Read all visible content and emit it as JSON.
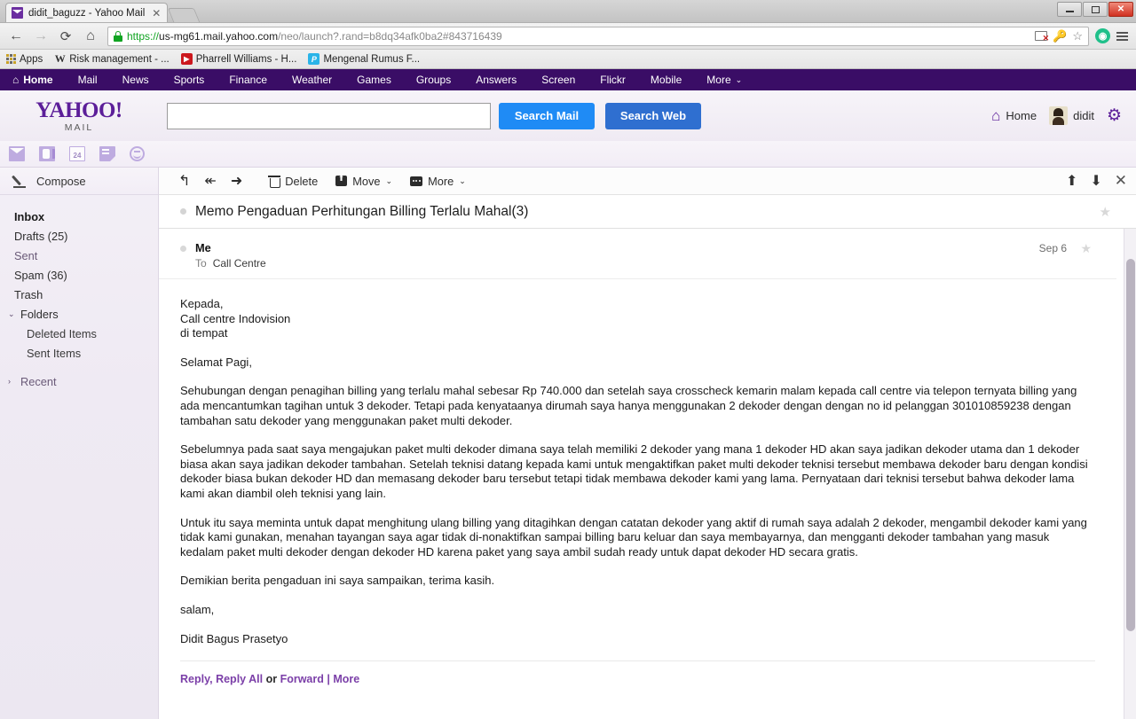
{
  "browser": {
    "tab_title": "didit_baguzz - Yahoo Mail",
    "tab_close": "✕",
    "url_scheme": "https://",
    "url_host": "us-mg61.mail.yahoo.com",
    "url_path": "/neo/launch?.rand=b8dq34afk0ba2#843716439",
    "back": "←",
    "forward": "→",
    "reload": "⟳",
    "home": "⌂",
    "minimize": "—",
    "maximize": "❐",
    "close": "✕",
    "bookmarks": [
      {
        "label": "Apps",
        "icon": "apps-grid-icon"
      },
      {
        "label": "Risk management - ...",
        "icon": "wikipedia-icon",
        "glyph": "W"
      },
      {
        "label": "Pharrell Williams - H...",
        "icon": "youtube-icon",
        "glyph": "▶"
      },
      {
        "label": "Mengenal Rumus F...",
        "icon": "site-icon",
        "glyph": "P"
      }
    ]
  },
  "yahoo_nav": {
    "items": [
      {
        "label": "Home",
        "icon": "home-icon"
      },
      {
        "label": "Mail"
      },
      {
        "label": "News"
      },
      {
        "label": "Sports"
      },
      {
        "label": "Finance"
      },
      {
        "label": "Weather"
      },
      {
        "label": "Games"
      },
      {
        "label": "Groups"
      },
      {
        "label": "Answers"
      },
      {
        "label": "Screen"
      },
      {
        "label": "Flickr"
      },
      {
        "label": "Mobile"
      },
      {
        "label": "More",
        "caret": "⌄"
      }
    ]
  },
  "mail_header": {
    "logo_main": "YAHOO!",
    "logo_sub": "MAIL",
    "search_value": "",
    "search_placeholder": "",
    "search_mail_label": "Search Mail",
    "search_web_label": "Search Web",
    "home_label": "Home",
    "user_name": "didit",
    "gear": "⚙"
  },
  "app_strip": {
    "icons": [
      "mail-icon",
      "contacts-icon",
      "calendar-icon",
      "notepad-icon",
      "smiley-icon"
    ],
    "calendar_number": "24"
  },
  "sidebar": {
    "compose_label": "Compose",
    "folders": [
      {
        "label": "Inbox",
        "state": "active"
      },
      {
        "label": "Drafts (25)",
        "state": "normal"
      },
      {
        "label": "Sent",
        "state": "normal"
      },
      {
        "label": "Spam (36)",
        "state": "normal"
      },
      {
        "label": "Trash",
        "state": "normal"
      },
      {
        "label": "Folders",
        "state": "group",
        "chev": "⌄"
      },
      {
        "label": "Deleted Items",
        "state": "sub"
      },
      {
        "label": "Sent Items",
        "state": "sub"
      },
      {
        "label": "Recent",
        "state": "group",
        "chev": "›"
      }
    ]
  },
  "toolbar": {
    "reply": "↰",
    "reply_all": "↞",
    "forward": "➜",
    "delete_label": "Delete",
    "move_label": "Move",
    "move_caret": "⌄",
    "more_label": "More",
    "more_caret": "⌄",
    "prev_message": "⬆",
    "next_message": "⬇",
    "close_message": "✕"
  },
  "message": {
    "subject": "Memo Pengaduan Perhitungan Billing Terlalu Mahal(3)",
    "sender": "Me",
    "to_label": "To",
    "to_recipient": "Call Centre",
    "date": "Sep 6",
    "star": "★",
    "paragraphs": [
      "Kepada,",
      "Call centre Indovision",
      "di tempat",
      "Selamat Pagi,",
      "Sehubungan dengan penagihan billing yang terlalu mahal sebesar Rp 740.000 dan  setelah saya crosscheck kemarin malam kepada call centre via telepon ternyata billing yang ada mencantumkan tagihan untuk 3 dekoder. Tetapi pada kenyataanya dirumah saya hanya menggunakan 2 dekoder dengan dengan no id pelanggan 301010859238 dengan tambahan satu dekoder yang menggunakan paket multi dekoder.",
      "Sebelumnya pada saat saya mengajukan paket multi dekoder dimana saya telah memiliki 2 dekoder yang mana 1 dekoder HD akan saya jadikan dekoder utama dan 1  dekoder biasa akan saya jadikan dekoder tambahan. Setelah teknisi datang kepada kami untuk mengaktifkan paket multi dekoder teknisi tersebut membawa dekoder baru dengan kondisi dekoder biasa bukan dekoder HD dan memasang dekoder baru tersebut tetapi tidak membawa dekoder kami yang lama. Pernyataan dari teknisi tersebut bahwa dekoder lama kami akan diambil oleh teknisi yang lain.",
      "Untuk itu saya meminta untuk dapat menghitung ulang billing yang ditagihkan dengan catatan dekoder yang aktif di rumah saya adalah 2 dekoder, mengambil dekoder kami yang tidak kami gunakan, menahan tayangan saya agar tidak di-nonaktifkan sampai billing baru keluar dan saya membayarnya, dan mengganti dekoder tambahan yang masuk kedalam paket multi dekoder dengan dekoder HD karena paket yang saya ambil sudah ready untuk dapat dekoder HD secara gratis.",
      "Demikian berita pengaduan ini saya sampaikan, terima kasih.",
      "salam,",
      "Didit Bagus Prasetyo"
    ],
    "footer": {
      "reply": "Reply,",
      "reply_all": "Reply All",
      "or": "or",
      "forward": "Forward",
      "separator": "|",
      "more": "More"
    }
  },
  "colors": {
    "yahoo_purple": "#3a0d66",
    "logo_purple": "#5c1e99",
    "search_mail_blue": "#1f8bf5",
    "search_web_blue": "#2f6fd0",
    "link_purple": "#7b3fa8"
  }
}
